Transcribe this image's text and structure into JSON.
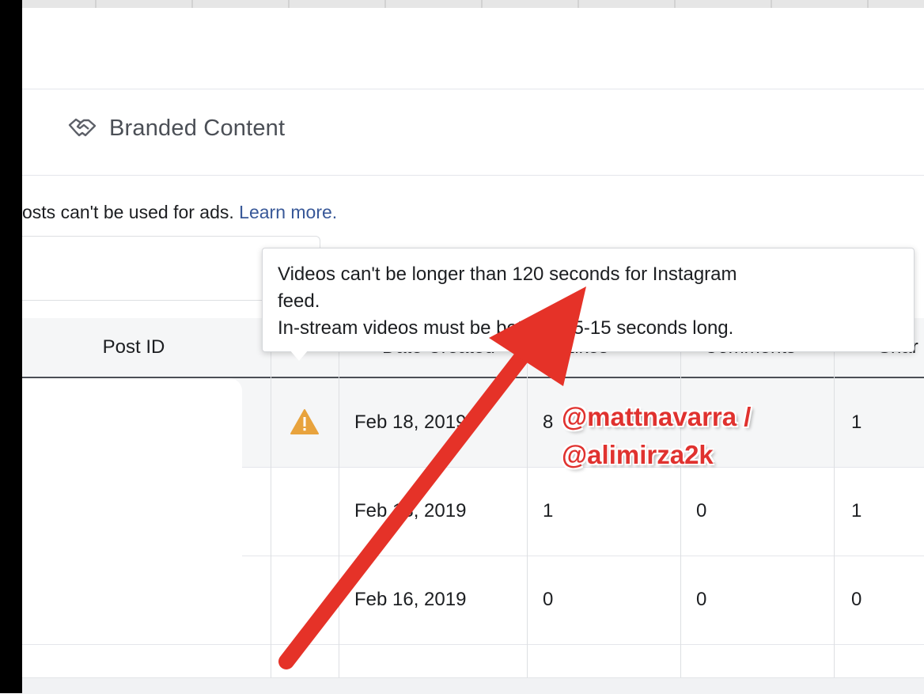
{
  "section": {
    "label": "Branded Content",
    "icon": "handshake-icon"
  },
  "notice": {
    "text": "osts can't be used for ads.",
    "link": "Learn more."
  },
  "table": {
    "columns": [
      "Post ID",
      "Date Created",
      "Likes",
      "Comments",
      "Shar"
    ],
    "rows": [
      {
        "status_icon": "warning-icon",
        "date": "Feb 18, 2019",
        "likes": "8",
        "comments": "",
        "shares": "1"
      },
      {
        "status_icon": "",
        "date": "Feb 18, 2019",
        "likes": "1",
        "comments": "0",
        "shares": "1"
      },
      {
        "status_icon": "",
        "date": "Feb 16, 2019",
        "likes": "0",
        "comments": "0",
        "shares": "0"
      }
    ]
  },
  "tooltip": {
    "line1": "Videos can't be longer than 120 seconds for Instagram",
    "line2": "feed.",
    "line3": "In-stream videos must be between 5-15 seconds long."
  },
  "watermark": {
    "line1": "@mattnavarra /",
    "line2": "@alimirza2k"
  },
  "colors": {
    "link": "#385898",
    "warning": "#e8a33d",
    "arrow": "#e53228",
    "watermark": "#e0322f"
  }
}
